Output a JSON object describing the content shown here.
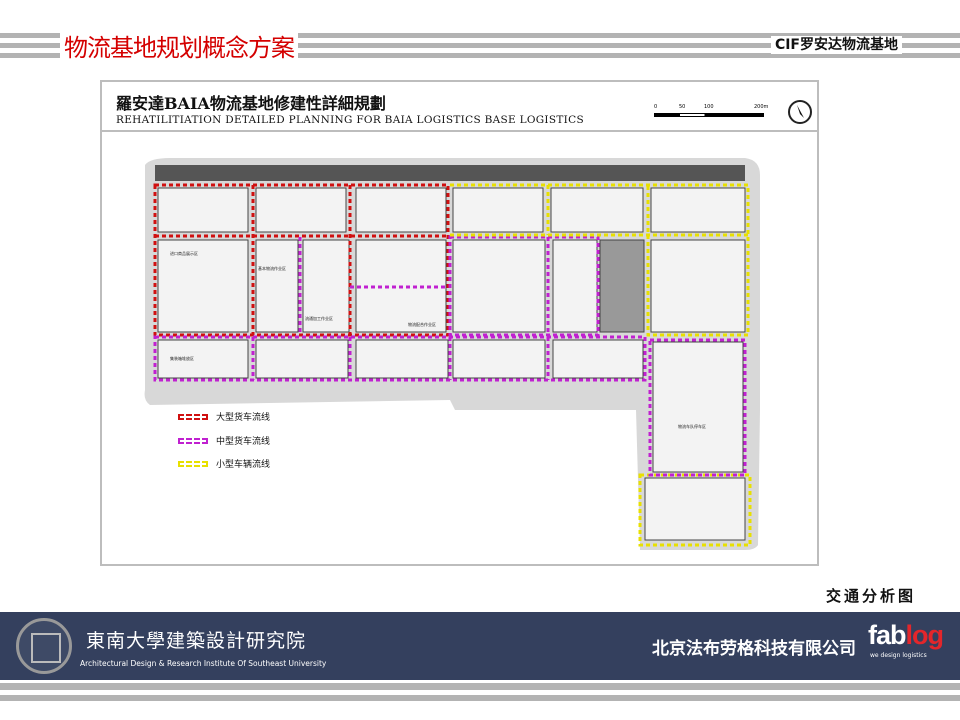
{
  "header": {
    "title": "物流基地规划概念方案",
    "brand": "CIF罗安达物流基地"
  },
  "plan": {
    "title_cn": "羅安達BAIA物流基地修建性詳細規劃",
    "title_en": "REHATILITIATION DETAILED PLANNING FOR BAIA LOGISTICS BASE LOGISTICS",
    "scale_labels": [
      "0",
      "50",
      "100",
      "200m"
    ],
    "legend": [
      {
        "label": "大型货车流线",
        "color": "#d01010"
      },
      {
        "label": "中型货车流线",
        "color": "#c020d0"
      },
      {
        "label": "小型车辆流线",
        "color": "#e8e000"
      }
    ],
    "zones": [
      "进口商品展示区",
      "基本物流作业区",
      "流通加工作业区",
      "物流配合作业区",
      "集装箱堆放区",
      "物流车队停车区"
    ]
  },
  "caption": "交通分析图",
  "footer": {
    "institute_cn": "東南大學建築設計研究院",
    "institute_en": "Architectural Design & Research Institute Of Southeast University",
    "company_cn": "北京法布劳格科技有限公司",
    "logo_a": "fab",
    "logo_b": "log",
    "logo_sub": "we design logistics"
  }
}
